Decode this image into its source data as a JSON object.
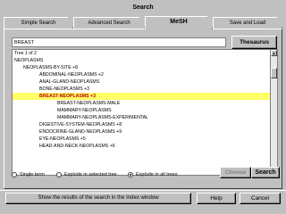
{
  "window": {
    "title": "Search"
  },
  "tabs": [
    {
      "label": "Simple Search"
    },
    {
      "label": "Advanced Search"
    },
    {
      "label": "MeSH"
    },
    {
      "label": "Save and Load"
    }
  ],
  "active_tab": "MeSH",
  "search": {
    "value": "BREAST"
  },
  "buttons": {
    "thesaurus": "Thesaurus",
    "choose": "Choose",
    "search": "Search",
    "show_results": "Show the results of the search in the Index window",
    "help": "Help",
    "cancel": "Cancel"
  },
  "tree": {
    "rows": [
      {
        "text": "Tree 1 of 2",
        "bold": true,
        "highlight": false
      },
      {
        "text": "NEOPLASMS",
        "bold": true,
        "highlight": false
      },
      {
        "text": "NEOPLASMS-BY-SITE +8",
        "bold": false,
        "highlight": false
      },
      {
        "text": "ABDOMINAL-NEOPLASMS +2",
        "bold": false,
        "highlight": false
      },
      {
        "text": "ANAL-GLAND-NEOPLASMS",
        "bold": false,
        "highlight": false
      },
      {
        "text": "BONE-NEOPLASMS +3",
        "bold": false,
        "highlight": false
      },
      {
        "text": "BREAST-NEOPLASMS +3",
        "bold": true,
        "highlight": true
      },
      {
        "text": "BREAST-NEOPLASMS-MALE",
        "bold": false,
        "highlight": false
      },
      {
        "text": "MAMMARY-NEOPLASMS",
        "bold": false,
        "highlight": false
      },
      {
        "text": "MAMMARY-NEOPLASMS-EXPERIMENTAL",
        "bold": false,
        "highlight": false
      },
      {
        "text": "DIGESTIVE-SYSTEM-NEOPLASMS +8",
        "bold": false,
        "highlight": false
      },
      {
        "text": "ENDOCRINE-GLAND-NEOPLASMS +9",
        "bold": false,
        "highlight": false
      },
      {
        "text": "EYE-NEOPLASMS +5",
        "bold": false,
        "highlight": false
      },
      {
        "text": "HEAD-AND-NECK-NEOPLASMS +6",
        "bold": false,
        "highlight": false
      }
    ]
  },
  "radios": [
    {
      "label": "Single term",
      "checked": false
    },
    {
      "label": "Explode in selected tree",
      "checked": false
    },
    {
      "label": "Explode in all trees",
      "checked": true
    }
  ],
  "scrollbar_icons": {
    "up": "up-arrow-icon",
    "down": "down-arrow-icon"
  }
}
